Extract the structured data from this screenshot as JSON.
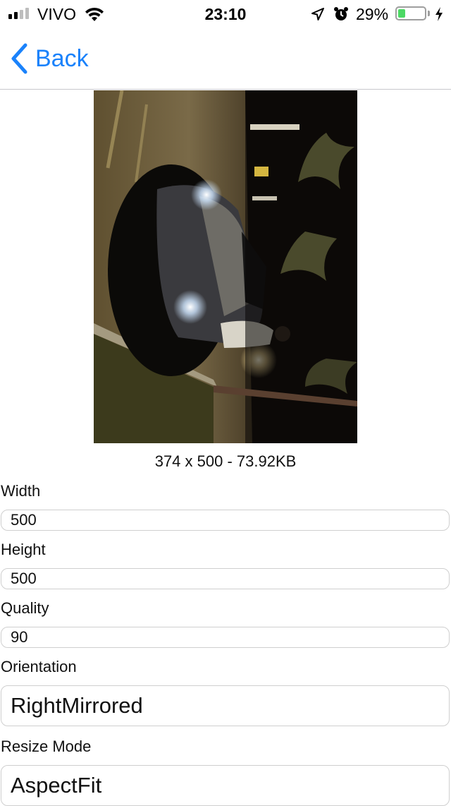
{
  "status_bar": {
    "carrier": "VIVO",
    "time": "23:10",
    "battery_percent": "29%",
    "battery_level": 0.29,
    "icons": [
      "signal-icon",
      "wifi-icon",
      "location-arrow-icon",
      "alarm-icon",
      "battery-icon",
      "charging-bolt-icon"
    ]
  },
  "nav": {
    "back_label": "Back",
    "accent_color": "#1a82fb"
  },
  "image": {
    "caption": "374 x 500 - 73.92KB"
  },
  "form": {
    "width": {
      "label": "Width",
      "value": "500"
    },
    "height": {
      "label": "Height",
      "value": "500"
    },
    "quality": {
      "label": "Quality",
      "value": "90"
    },
    "orientation": {
      "label": "Orientation",
      "value": "RightMirrored"
    },
    "resize_mode": {
      "label": "Resize Mode",
      "value": "AspectFit"
    }
  }
}
